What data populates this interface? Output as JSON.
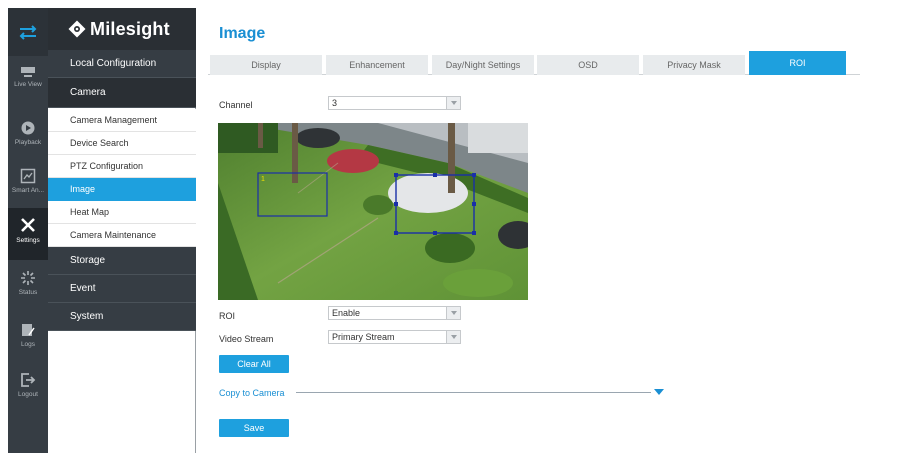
{
  "rail": {
    "items": [
      {
        "label": "",
        "icon": "menu-arrows-icon"
      },
      {
        "label": "Live View",
        "icon": "monitor-icon"
      },
      {
        "label": "Playback",
        "icon": "playback-icon"
      },
      {
        "label": "Smart An...",
        "icon": "smart-analytics-icon"
      },
      {
        "label": "Settings",
        "icon": "settings-tools-icon"
      },
      {
        "label": "Status",
        "icon": "status-icon"
      },
      {
        "label": "Logs",
        "icon": "logs-icon"
      },
      {
        "label": "Logout",
        "icon": "logout-icon"
      }
    ],
    "active": "Settings"
  },
  "brand": {
    "name": "Milesight"
  },
  "menu": {
    "local_configuration": "Local Configuration",
    "camera": "Camera",
    "camera_items": [
      "Camera Management",
      "Device Search",
      "PTZ Configuration",
      "Image",
      "Heat Map",
      "Camera Maintenance"
    ],
    "active_item": "Image",
    "storage": "Storage",
    "event": "Event",
    "system": "System"
  },
  "page": {
    "title": "Image",
    "tabs": [
      "Display",
      "Enhancement",
      "Day/Night Settings",
      "OSD",
      "Privacy Mask",
      "ROI"
    ],
    "active_tab": "ROI"
  },
  "form": {
    "channel_label": "Channel",
    "channel_value": "3",
    "roi_label": "ROI",
    "roi_value": "Enable",
    "video_stream_label": "Video Stream",
    "video_stream_value": "Primary Stream",
    "roi_region_number": "1",
    "clear_all": "Clear All",
    "copy_to_camera": "Copy to Camera",
    "save": "Save"
  },
  "colors": {
    "accent": "#1ea0de",
    "sidebar_dark": "#2a2f34",
    "roi_box": "#1a2fa8"
  }
}
